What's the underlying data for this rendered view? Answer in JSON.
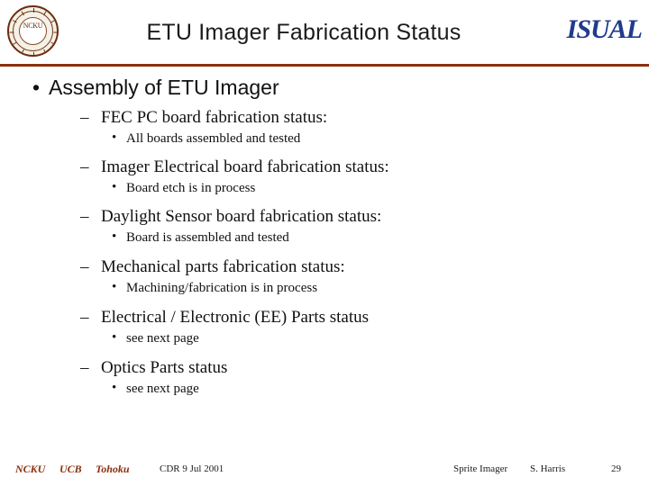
{
  "header": {
    "title": "ETU Imager Fabrication Status",
    "logo_text": "ISUAL",
    "seal_text": "NCKU"
  },
  "content": {
    "level1": "Assembly of ETU Imager",
    "bullet_marker_1": "•",
    "bullet_marker_2": "–",
    "bullet_marker_3": "•",
    "items": [
      {
        "heading": "FEC PC board fabrication status:",
        "detail": "All boards assembled and tested"
      },
      {
        "heading": "Imager Electrical board fabrication status:",
        "detail": "Board etch is in process"
      },
      {
        "heading": "Daylight Sensor board fabrication status:",
        "detail": "Board is assembled and tested"
      },
      {
        "heading": "Mechanical parts fabrication status:",
        "detail": "Machining/fabrication is in process"
      },
      {
        "heading": "Electrical / Electronic (EE) Parts status",
        "detail": "see next page"
      },
      {
        "heading": "Optics Parts status",
        "detail": "see next page"
      }
    ]
  },
  "footer": {
    "ncku": "NCKU",
    "ucb": "UCB",
    "tohoku": "Tohoku",
    "cdr": "CDR  9 Jul 2001",
    "sprite_imager": "Sprite Imager",
    "author": "S. Harris",
    "page": "29"
  },
  "colors": {
    "accent_rule": "#8b2f0d",
    "logo_blue": "#1f3b8c",
    "footer_red": "#8b2f0d"
  }
}
